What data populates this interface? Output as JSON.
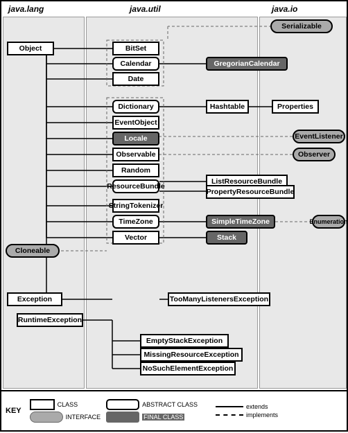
{
  "headers": {
    "java_lang": "java.lang",
    "java_util": "java.util",
    "java_io": "java.io"
  },
  "boxes": {
    "object": "Object",
    "cloneable": "Cloneable",
    "exception": "Exception",
    "runtime_exception": "RuntimeException",
    "bitset": "BitSet",
    "calendar": "Calendar",
    "date": "Date",
    "dictionary": "Dictionary",
    "event_object": "EventObject",
    "locale": "Locale",
    "observable": "Observable",
    "random": "Random",
    "resource_bundle": "ResourceBundle",
    "string_tokenizer": "StringTokenizer",
    "timezone": "TimeZone",
    "vector": "Vector",
    "gregorian_calendar": "GregorianCalendar",
    "hashtable": "Hashtable",
    "properties": "Properties",
    "list_resource_bundle": "ListResourceBundle",
    "property_resource_bundle": "PropertyResourceBundle",
    "simple_timezone": "SimpleTimeZone",
    "stack": "Stack",
    "too_many_listeners": "TooManyListenersException",
    "empty_stack": "EmptyStackException",
    "missing_resource": "MissingResourceException",
    "no_such_element": "NoSuchElementException",
    "serializable": "Serializable",
    "event_listener": "EventListener",
    "observer": "Observer",
    "enumeration": "Enumeration"
  },
  "key": {
    "label": "KEY",
    "class_label": "CLASS",
    "abstract_label": "ABSTRACT CLASS",
    "interface_label": "INTERFACE",
    "final_label": "FINAL CLASS",
    "extends_label": "extends",
    "implements_label": "implements"
  }
}
